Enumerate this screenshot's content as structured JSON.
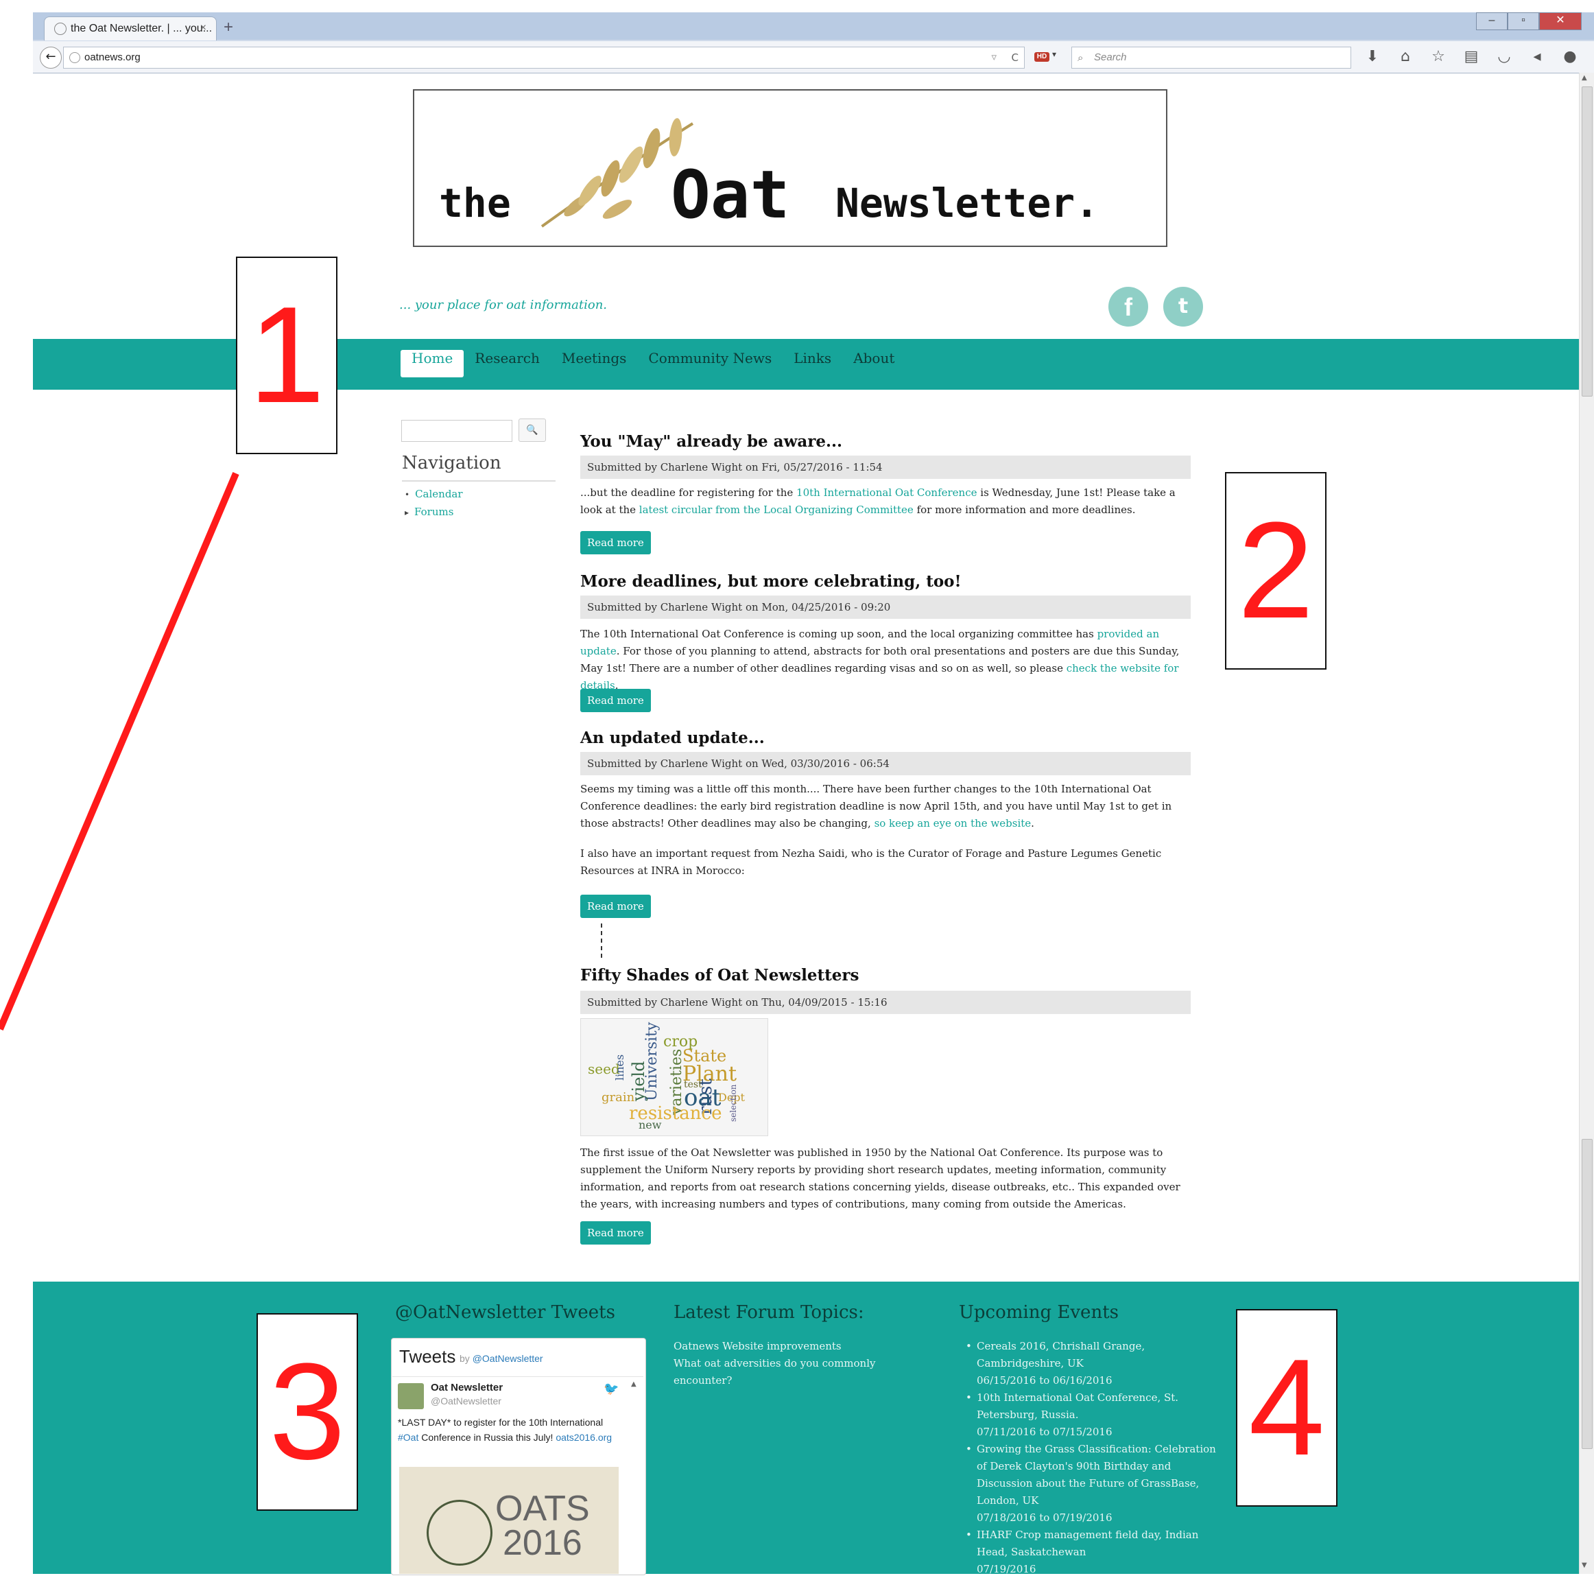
{
  "browser": {
    "tab_title": "the Oat Newsletter. | ... you...",
    "tab_close": "×",
    "new_tab": "+",
    "url": "oatnews.org",
    "search_placeholder": "Search",
    "hd_badge": "HD",
    "window_controls": [
      "–",
      "▫",
      "✕"
    ],
    "icons": [
      "download-icon",
      "home-icon",
      "bookmark-star-icon",
      "reading-list-icon",
      "pocket-icon",
      "send-icon",
      "chat-icon",
      "menu-icon"
    ]
  },
  "header": {
    "logo_the": "the",
    "logo_oat": "Oat",
    "logo_newsletter": "Newsletter.",
    "slogan": "... your place for oat information.",
    "facebook": "f",
    "twitter": "t"
  },
  "menu": [
    "Home",
    "Research",
    "Meetings",
    "Community News",
    "Links",
    "About"
  ],
  "sidebar": {
    "search_button": "🔍",
    "nav_title": "Navigation",
    "nav_items": [
      "Calendar",
      "Forums"
    ]
  },
  "articles": [
    {
      "title": "You \"May\" already be aware...",
      "meta": "Submitted by Charlene Wight on Fri, 05/27/2016 - 11:54",
      "p1_a": "...but the deadline for registering for the ",
      "p1_link1": "10th International Oat Conference",
      "p1_b": " is Wednesday, June 1st! Please take a look at the ",
      "p1_link2": "latest circular from the Local Organizing Committee",
      "p1_c": " for more information and more deadlines.",
      "read_more": "Read more"
    },
    {
      "title": "More deadlines, but more celebrating, too!",
      "meta": "Submitted by Charlene Wight on Mon, 04/25/2016 - 09:20",
      "p1_a": "The 10th International Oat Conference is coming up soon, and the local organizing committee has ",
      "p1_link1": "provided an update",
      "p1_b": ". For those of you planning to attend, abstracts for both oral presentations and posters are due this Sunday, May 1st! There are a number of other deadlines regarding visas and so on as well, so please ",
      "p1_link2": "check the website for details",
      "p1_c": ".",
      "read_more": "Read more"
    },
    {
      "title": "An updated update...",
      "meta": "Submitted by Charlene Wight on Wed, 03/30/2016 - 06:54",
      "p1_a": "Seems my timing was a little off this month.... There have been further changes to the 10th International Oat Conference deadlines: the early bird registration deadline is now April 15th, and you have until May 1st to get in those abstracts! Other deadlines may also be changing, ",
      "p1_link1": "so keep an eye on the website",
      "p1_b": ".",
      "p2": "I also have an important request from Nezha Saidi, who is the Curator of Forage and Pasture Legumes Genetic Resources at INRA in Morocco:",
      "read_more": "Read more"
    },
    {
      "title": "Fifty Shades of Oat Newsletters",
      "meta": "Submitted by Charlene Wight on Thu, 04/09/2015 - 15:16",
      "p1": "The first issue of the Oat Newsletter was published in 1950 by the National Oat Conference. Its purpose was to supplement the Uniform Nursery reports by providing short research updates, meeting information, community information, and reports from oat research stations concerning yields, disease outbreaks, etc.. This expanded over the years, with increasing numbers and types of contributions, many coming from outside the Americas.",
      "read_more": "Read more"
    }
  ],
  "wordcloud_words": [
    "crop",
    "State",
    "Plant",
    "University",
    "yield",
    "varieties",
    "rust",
    "oat",
    "test",
    "Dept",
    "grain",
    "resistance",
    "seed",
    "lines",
    "new",
    "selection"
  ],
  "footer": {
    "tweets_title": "@OatNewsletter Tweets",
    "tweets_head": "Tweets",
    "tweets_by": "by",
    "tweets_by_handle": "@OatNewsletter",
    "tweet_name": "Oat Newsletter",
    "tweet_handle": "@OatNewsletter",
    "tweet_text_a": "*LAST DAY* to register for the 10th International ",
    "tweet_hashtag": "#Oat",
    "tweet_text_b": " Conference in Russia this July! ",
    "tweet_link": "oats2016.org",
    "tweet_img_line1": "OATS",
    "tweet_img_line2": "2016",
    "forum_title": "Latest Forum Topics:",
    "forum_items": [
      "Oatnews Website improvements",
      "What oat adversities do you commonly encounter?"
    ],
    "events_title": "Upcoming Events",
    "events": [
      {
        "name": "Cereals 2016, Chrishall Grange, Cambridgeshire, UK",
        "date": "06/15/2016 to 06/16/2016"
      },
      {
        "name": "10th International Oat Conference, St. Petersburg, Russia.",
        "date": "07/11/2016 to 07/15/2016"
      },
      {
        "name": "Growing the Grass Classification: Celebration of Derek Clayton's 90th Birthday and Discussion about the Future of GrassBase, London, UK",
        "date": "07/18/2016 to 07/19/2016"
      },
      {
        "name": "IHARF Crop management field day, Indian Head, Saskatchewan",
        "date": "07/19/2016"
      }
    ]
  },
  "annotations": [
    "1",
    "2",
    "3",
    "4"
  ],
  "colors": {
    "accent": "#16a59a",
    "annotation": "#ff1a1a"
  }
}
